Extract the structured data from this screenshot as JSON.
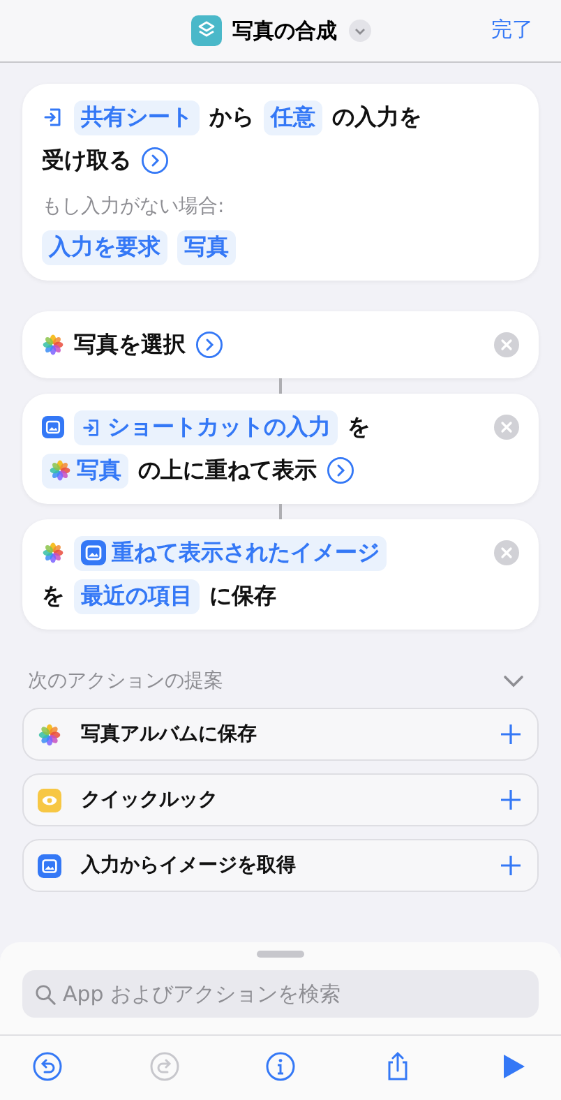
{
  "header": {
    "title": "写真の合成",
    "done": "完了"
  },
  "actions": [
    {
      "kind": "input",
      "removable": false,
      "lines": [
        {
          "parts": [
            {
              "kind": "token-plain",
              "text": "共有シート"
            },
            {
              "kind": "text",
              "text": "から"
            },
            {
              "kind": "token-plain",
              "text": "任意"
            },
            {
              "kind": "text",
              "text": "の入力を"
            }
          ]
        },
        {
          "parts": [
            {
              "kind": "text",
              "text": "受け取る"
            },
            {
              "kind": "detail"
            }
          ]
        },
        {
          "parts": [
            {
              "kind": "caption",
              "text": "もし入力がない場合:"
            }
          ]
        },
        {
          "parts": [
            {
              "kind": "token-plain",
              "text": "入力を要求"
            },
            {
              "kind": "token-plain",
              "text": "写真"
            }
          ]
        }
      ]
    },
    {
      "kind": "photos",
      "removable": true,
      "lines": [
        {
          "parts": [
            {
              "kind": "text",
              "text": "写真を選択"
            },
            {
              "kind": "detail"
            }
          ]
        }
      ]
    },
    {
      "kind": "image",
      "removable": true,
      "lines": [
        {
          "parts": [
            {
              "kind": "token-input",
              "text": "ショートカットの入力"
            },
            {
              "kind": "text",
              "text": "を"
            }
          ]
        },
        {
          "parts": [
            {
              "kind": "token-photos",
              "text": "写真"
            },
            {
              "kind": "text",
              "text": "の上に重ねて表示"
            },
            {
              "kind": "detail"
            }
          ]
        }
      ]
    },
    {
      "kind": "photos",
      "removable": true,
      "lines": [
        {
          "parts": [
            {
              "kind": "token-image",
              "text": "重ねて表示されたイメージ"
            }
          ]
        },
        {
          "parts": [
            {
              "kind": "text",
              "text": "を"
            },
            {
              "kind": "token-plain",
              "text": "最近の項目"
            },
            {
              "kind": "text",
              "text": "に保存"
            }
          ]
        }
      ]
    }
  ],
  "suggestions": {
    "title": "次のアクションの提案",
    "expanded": true,
    "items": [
      {
        "kind": "photos",
        "label": "写真アルバムに保存"
      },
      {
        "kind": "eye",
        "label": "クイックルック"
      },
      {
        "kind": "image",
        "label": "入力からイメージを取得"
      }
    ]
  },
  "search": {
    "placeholder": "App およびアクションを検索"
  },
  "toolbar": [
    {
      "kind": "undo",
      "disabled": false
    },
    {
      "kind": "redo",
      "disabled": true
    },
    {
      "kind": "info",
      "disabled": false
    },
    {
      "kind": "share",
      "disabled": false
    },
    {
      "kind": "run",
      "disabled": false
    }
  ]
}
